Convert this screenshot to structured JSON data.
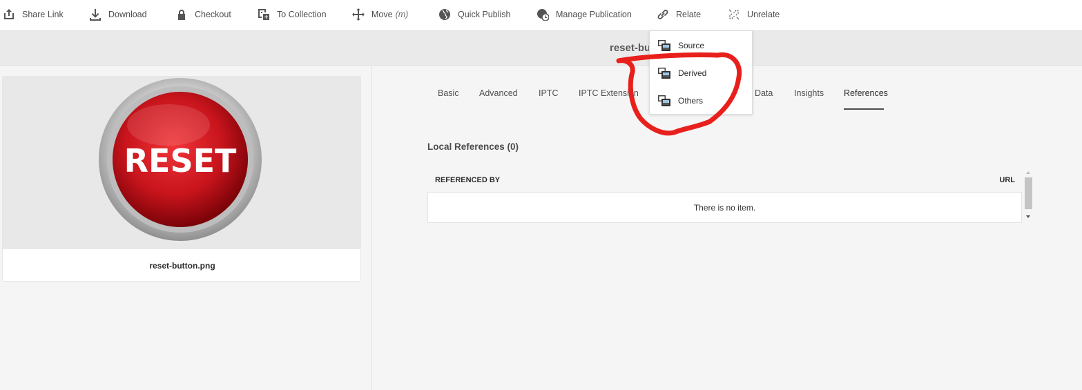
{
  "toolbar": {
    "items": [
      {
        "label": "Share Link",
        "icon": "share-icon"
      },
      {
        "label": "Download",
        "icon": "download-icon"
      },
      {
        "label": "Checkout",
        "icon": "lock-icon"
      },
      {
        "label": "To Collection",
        "icon": "add-collection-icon"
      },
      {
        "label": "Move",
        "shortcut": "(m)",
        "icon": "move-icon"
      },
      {
        "label": "Quick Publish",
        "icon": "globe-icon"
      },
      {
        "label": "Manage Publication",
        "icon": "globe-clock-icon"
      },
      {
        "label": "Relate",
        "icon": "link-icon"
      },
      {
        "label": "Unrelate",
        "icon": "unlink-icon"
      }
    ]
  },
  "header": {
    "title": "reset-bu"
  },
  "asset": {
    "filename": "reset-button.png",
    "thumbnail_text": "RESET"
  },
  "tabs": [
    {
      "label": "Basic",
      "active": false
    },
    {
      "label": "Advanced",
      "active": false
    },
    {
      "label": "IPTC",
      "active": false
    },
    {
      "label": "IPTC Extension",
      "active": false
    },
    {
      "label": "t Data",
      "active": false
    },
    {
      "label": "Insights",
      "active": false
    },
    {
      "label": "References",
      "active": true
    }
  ],
  "references": {
    "heading": "Local References (0)",
    "columns": [
      "REFERENCED BY",
      "URL"
    ],
    "empty_text": "There is no item."
  },
  "relate_menu": {
    "items": [
      {
        "label": "Source",
        "icon": "asset-relation-icon"
      },
      {
        "label": "Derived",
        "icon": "asset-relation-icon"
      },
      {
        "label": "Others",
        "icon": "asset-relation-icon"
      }
    ]
  },
  "colors": {
    "annotation": "#e8201c",
    "thumbnail_button": "#c8141c"
  }
}
